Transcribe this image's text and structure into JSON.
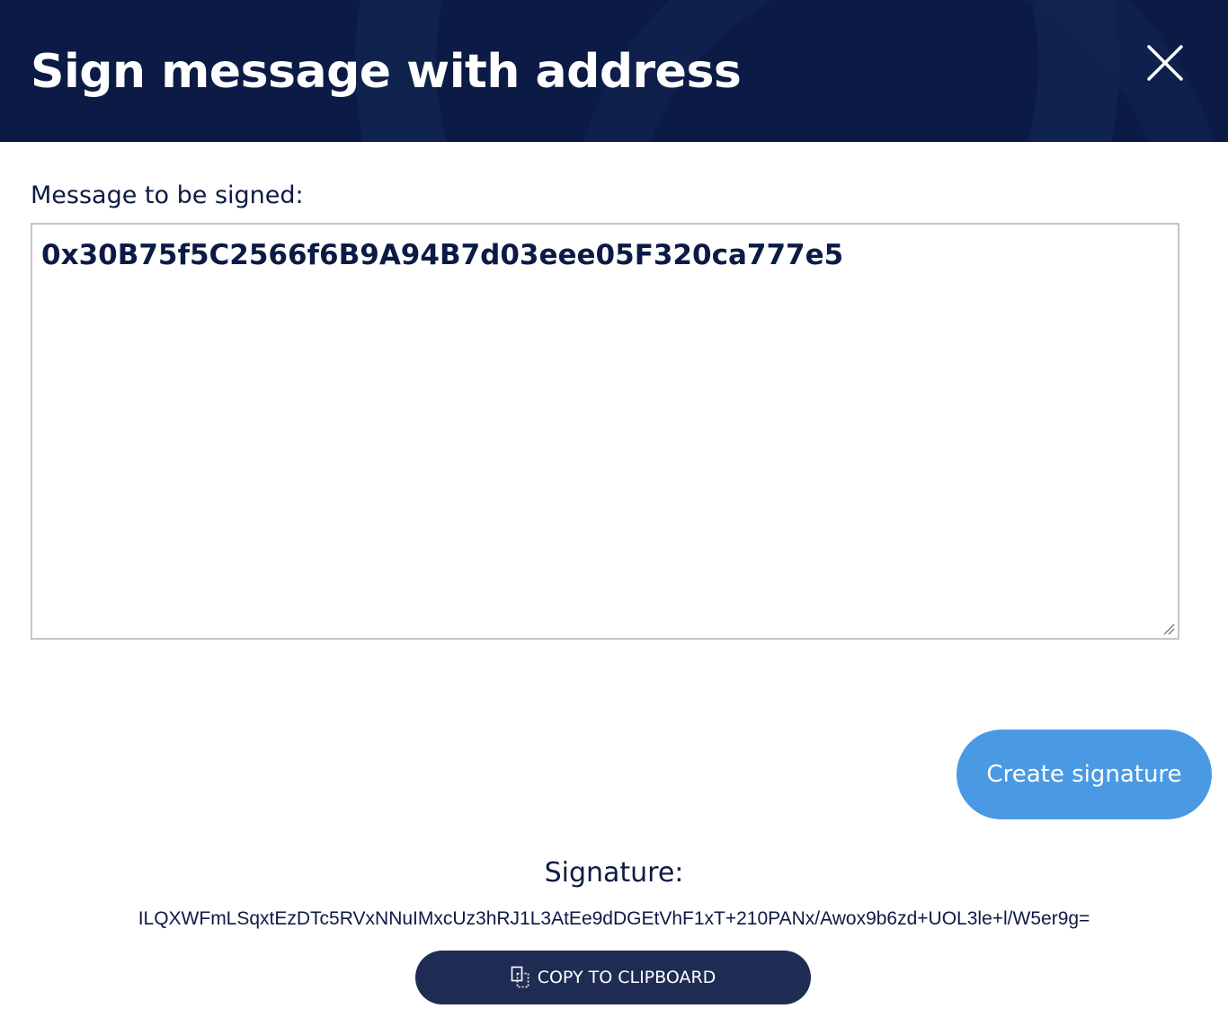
{
  "modal": {
    "title": "Sign message with address",
    "close_icon": "close-icon",
    "colors": {
      "header_background": "#0c1b45",
      "accent_button": "#4a9ae3",
      "dark_button": "#1f2d55",
      "text_dark": "#0c1b45"
    }
  },
  "form": {
    "message_label": "Message to be signed:",
    "message_value": "0x30B75f5C2566f6B9A94B7d03eee05F320ca777e5",
    "create_signature_label": "Create signature"
  },
  "result": {
    "signature_label": "Signature:",
    "signature_value": "ILQXWFmLSqxtEzDTc5RVxNNuIMxcUz3hRJ1L3AtEe9dDGEtVhF1xT+210PANx/Awox9b6zd+UOL3le+l/W5er9g=",
    "copy_button_label": "COPY TO CLIPBOARD",
    "copy_icon": "copy-icon"
  }
}
